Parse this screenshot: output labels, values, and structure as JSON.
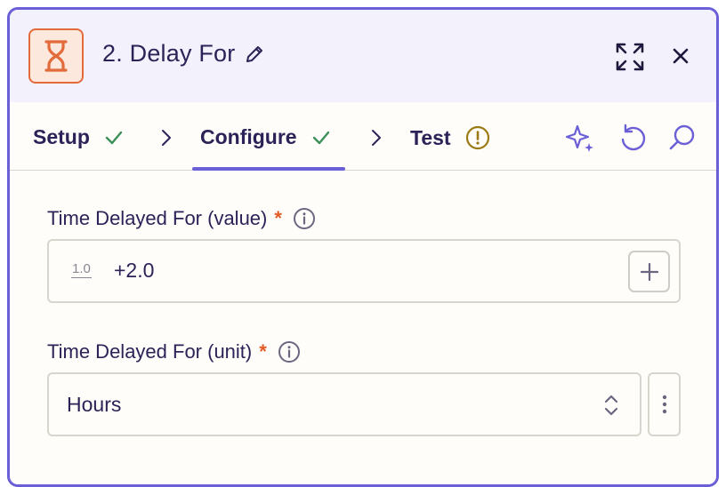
{
  "header": {
    "title": "2. Delay For",
    "app_icon": "hourglass-icon",
    "accent_color": "#e36a3a"
  },
  "tabs": [
    {
      "label": "Setup",
      "status": "check"
    },
    {
      "label": "Configure",
      "status": "check",
      "active": true
    },
    {
      "label": "Test",
      "status": "warning"
    }
  ],
  "toolbar": {
    "icons": [
      "sparkle-icon",
      "undo-icon",
      "search-icon"
    ]
  },
  "fields": {
    "value_field": {
      "label": "Time Delayed For (value)",
      "required_mark": "*",
      "type_badge": "1.0",
      "value": "+2.0"
    },
    "unit_field": {
      "label": "Time Delayed For (unit)",
      "required_mark": "*",
      "selected": "Hours"
    }
  },
  "colors": {
    "primary": "#6a5fd6",
    "check": "#3d8f5a",
    "warning": "#9a7a12",
    "required": "#e35a24",
    "text": "#2b2358"
  }
}
